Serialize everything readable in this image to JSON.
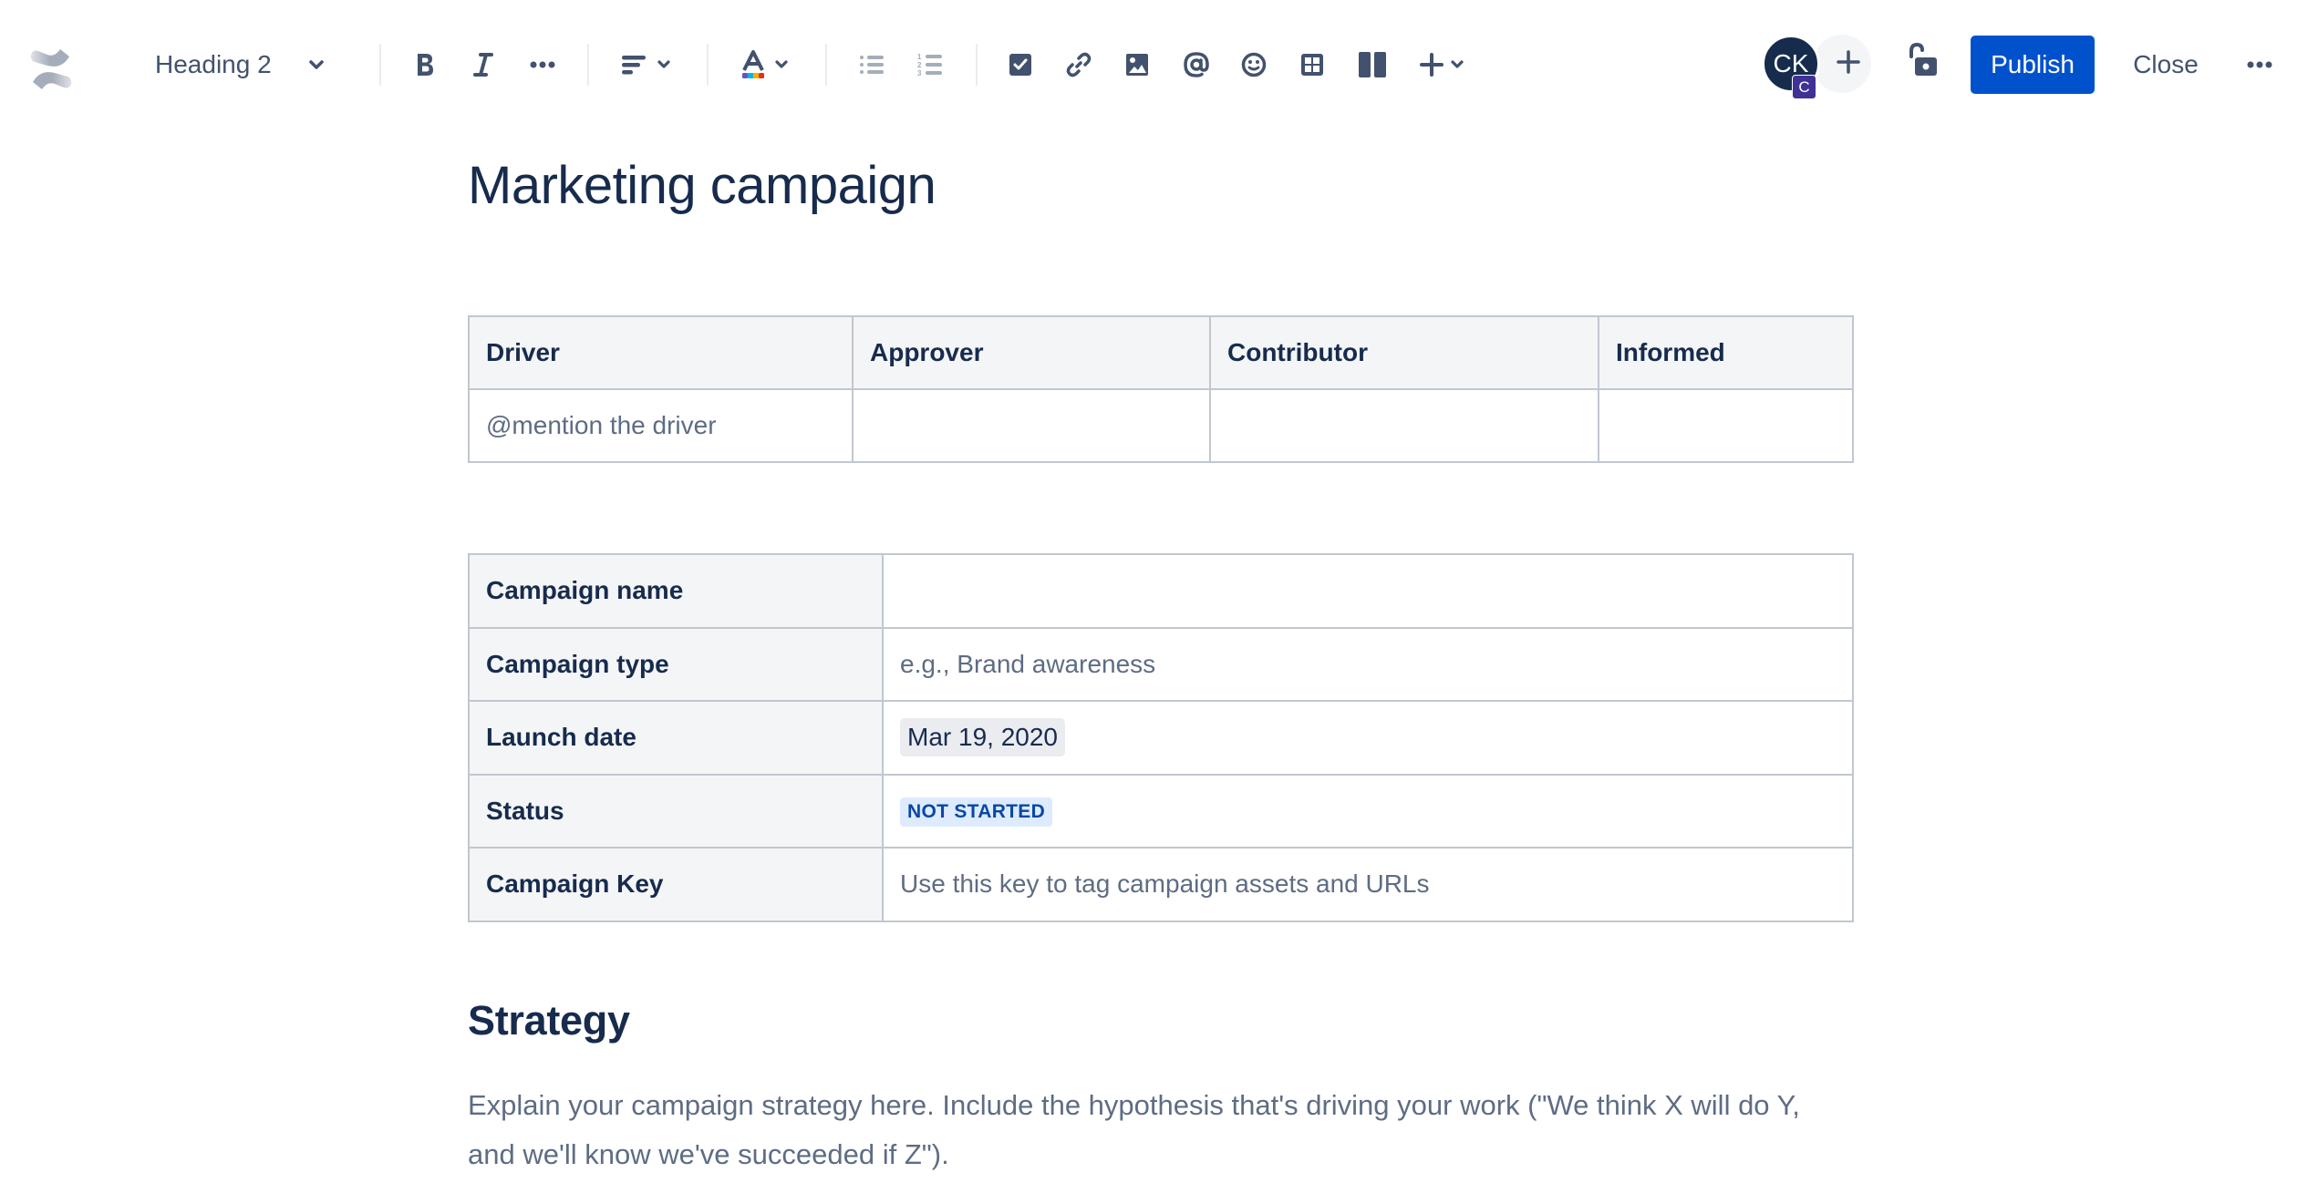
{
  "toolbar": {
    "logo": "confluence-logo",
    "text_style": {
      "value": "Heading 2",
      "icon": "chevron-down-icon"
    },
    "formatting": [
      {
        "name": "bold",
        "icon": "bold-icon"
      },
      {
        "name": "italic",
        "icon": "italic-icon"
      },
      {
        "name": "more-formatting",
        "icon": "more-horizontal-icon"
      }
    ],
    "alignment": {
      "icon": "align-left-icon",
      "dropdown": "chevron-down-icon"
    },
    "text_color": {
      "icon": "text-color-icon",
      "dropdown": "chevron-down-icon"
    },
    "lists": [
      {
        "name": "bullet-list",
        "icon": "bullet-list-icon"
      },
      {
        "name": "numbered-list",
        "icon": "numbered-list-icon"
      }
    ],
    "inserts": [
      {
        "name": "action-item",
        "icon": "checkbox-icon"
      },
      {
        "name": "link",
        "icon": "link-icon"
      },
      {
        "name": "image",
        "icon": "image-icon"
      },
      {
        "name": "mention",
        "icon": "mention-icon"
      },
      {
        "name": "emoji",
        "icon": "emoji-icon"
      },
      {
        "name": "table",
        "icon": "table-icon"
      },
      {
        "name": "layouts",
        "icon": "layout-icon"
      },
      {
        "name": "insert-more",
        "icon": "plus-icon"
      }
    ],
    "collaborator": {
      "initials": "CK",
      "badge": "C"
    },
    "invite_icon": "plus-icon",
    "restrictions_icon": "unlock-icon",
    "publish_label": "Publish",
    "close_label": "Close",
    "more_icon": "more-horizontal-icon"
  },
  "page": {
    "title": "Marketing campaign",
    "roles_table": {
      "headers": [
        "Driver",
        "Approver",
        "Contributor",
        "Informed"
      ],
      "rows": [
        [
          "@mention the driver",
          "",
          "",
          ""
        ]
      ]
    },
    "details_table": {
      "rows": [
        {
          "label": "Campaign name",
          "value": ""
        },
        {
          "label": "Campaign type",
          "value": "e.g., Brand awareness"
        },
        {
          "label": "Launch date",
          "value": "Mar 19, 2020"
        },
        {
          "label": "Status",
          "value": "NOT STARTED"
        },
        {
          "label": "Campaign Key",
          "value": "Use this key to tag campaign assets and URLs"
        }
      ]
    },
    "strategy": {
      "heading": "Strategy",
      "body": "Explain your campaign strategy here. Include the hypothesis that's driving your work (\"We think X will do Y, and we'll know we've succeeded if Z\")."
    }
  },
  "colors": {
    "primary": "#0052CC",
    "text": "#172B4D",
    "subtle_text": "#5E6C84",
    "icon": "#42526E",
    "table_header_bg": "#F4F5F7",
    "table_border": "#C1C7D0",
    "status_bg": "#DEEBFF",
    "status_text": "#0747A6",
    "avatar_bg": "#172B4D",
    "avatar_badge_bg": "#403294"
  }
}
